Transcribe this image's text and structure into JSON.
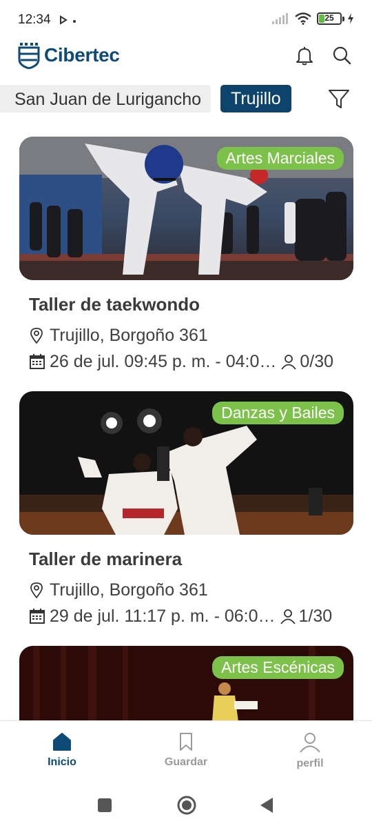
{
  "status_bar": {
    "time": "12:34",
    "battery": "25"
  },
  "header": {
    "brand": "Cibertec",
    "icons": [
      "bell-icon",
      "search-icon"
    ]
  },
  "filters": {
    "chip_1": "San Juan de Lurigancho",
    "chip_2": "Trujillo"
  },
  "events": [
    {
      "category": "Artes Marciales",
      "title": "Taller de taekwondo",
      "location": "Trujillo, Borgoño 361",
      "datetime": "26 de jul. 09:45 p. m. - 04:0…",
      "capacity": "0/30"
    },
    {
      "category": "Danzas y Bailes",
      "title": "Taller de marinera",
      "location": "Trujillo, Borgoño 361",
      "datetime": "29 de jul. 11:17 p. m. - 06:0…",
      "capacity": "1/30"
    },
    {
      "category": "Artes Escénicas"
    }
  ],
  "nav": {
    "home": "Inicio",
    "saved": "Guardar",
    "profile": "perfil"
  },
  "colors": {
    "brand": "#0d4a78",
    "badge": "#7cc24a",
    "chip_active": "#0e446b"
  }
}
